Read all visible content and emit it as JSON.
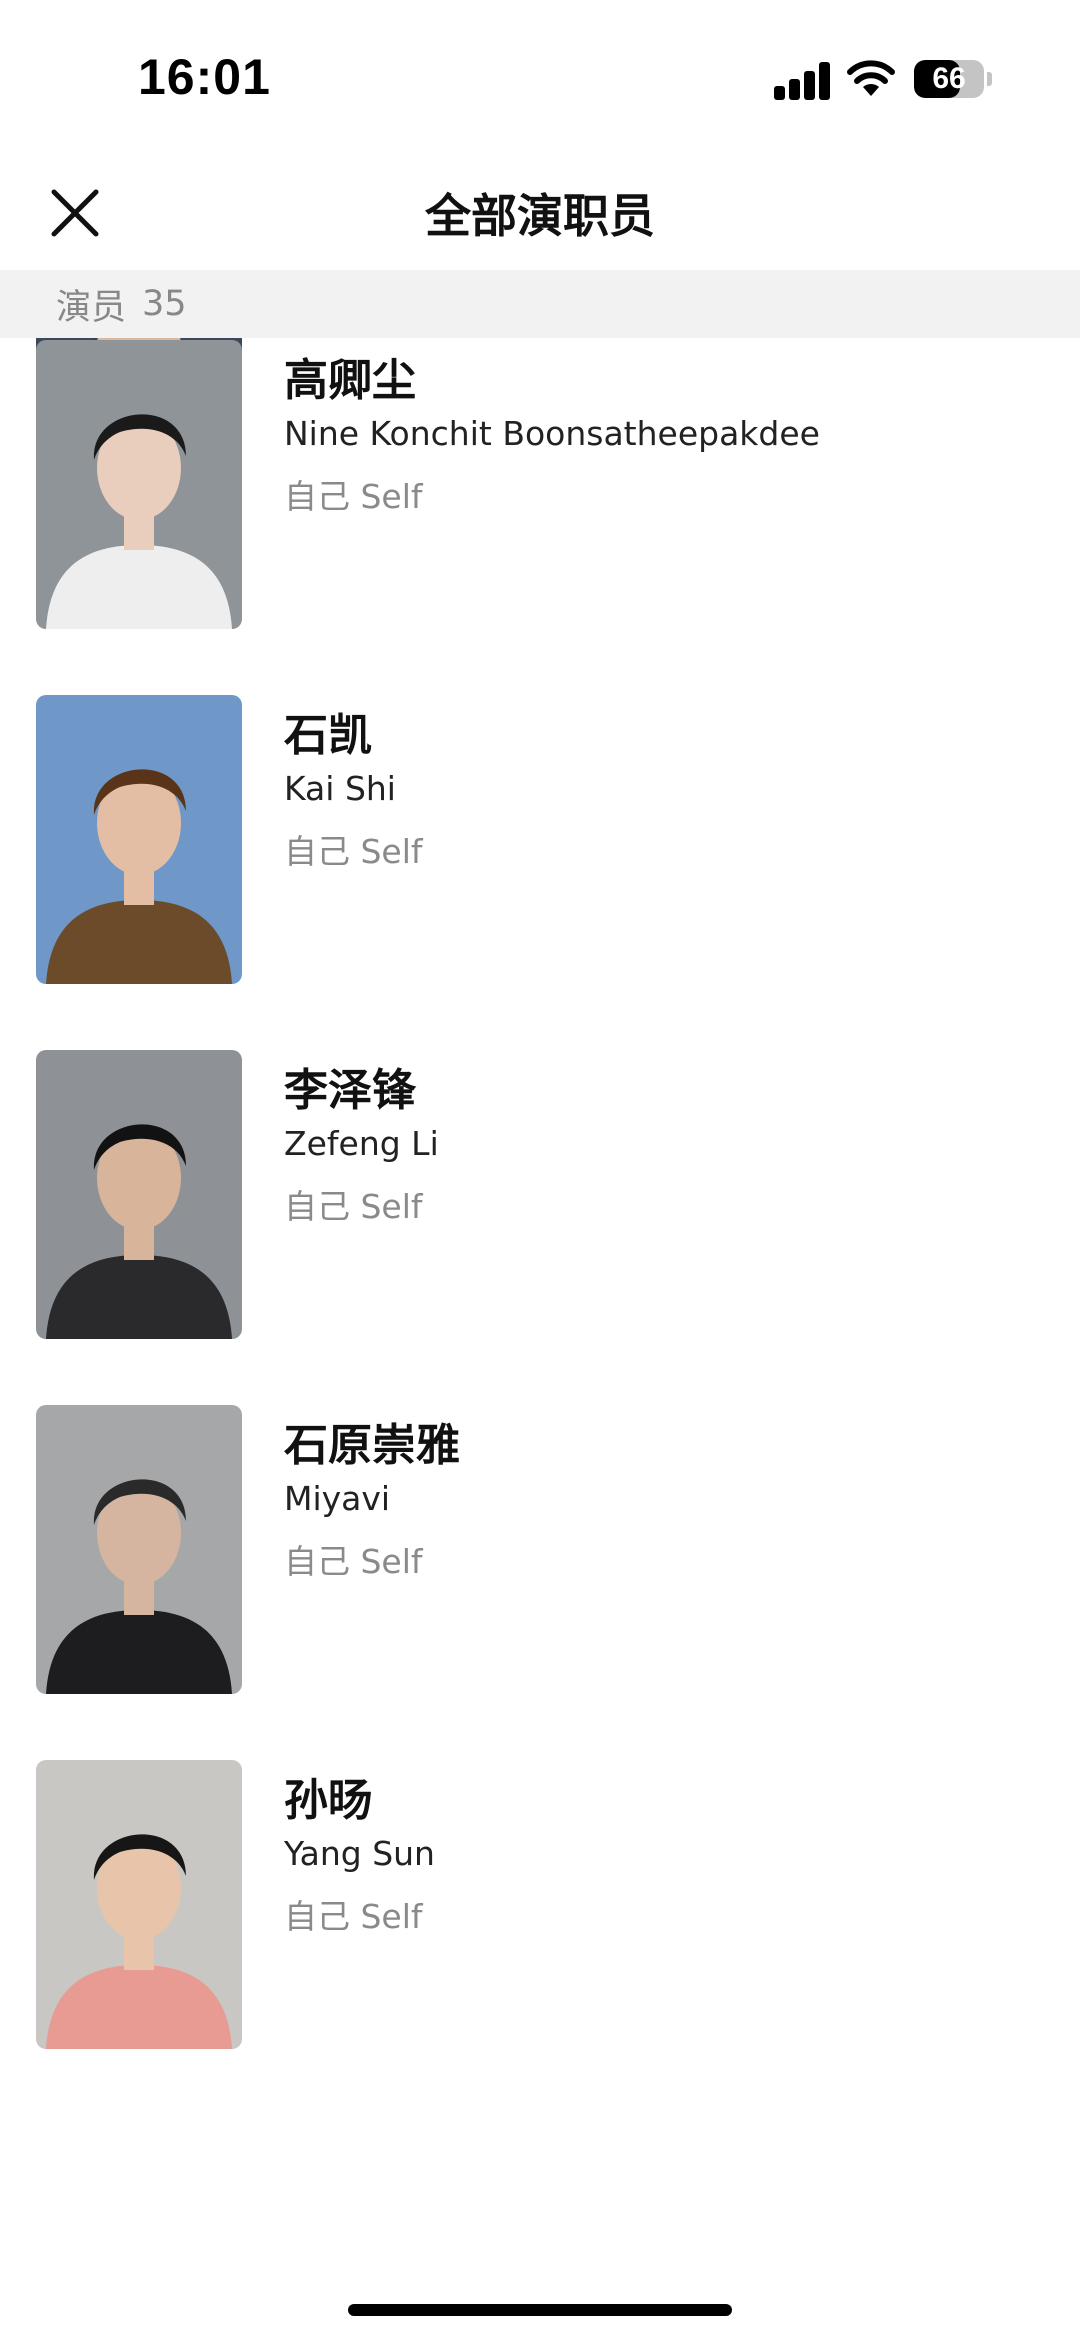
{
  "status_bar": {
    "time": "16:01",
    "battery": "66",
    "battery_level": 0.66
  },
  "nav": {
    "title": "全部演职员",
    "close_icon": "close-icon"
  },
  "section": {
    "label": "演员",
    "count": "35"
  },
  "cast": [
    {
      "name_cn": "",
      "name_en": "",
      "role": "",
      "photo_colors": {
        "bg": "#3a4a5c",
        "clothes": "#c9d3de",
        "skin": "#d9b8a0",
        "hair": "#1c1c1c"
      }
    },
    {
      "name_cn": "高卿尘",
      "name_en": "Nine Konchit Boonsatheepakdee",
      "role": "自己 Self",
      "photo_colors": {
        "bg": "#8f9499",
        "clothes": "#eeeeee",
        "skin": "#e9cdbd",
        "hair": "#1a1a1a"
      }
    },
    {
      "name_cn": "石凯",
      "name_en": "Kai Shi",
      "role": "自己 Self",
      "photo_colors": {
        "bg": "#6f98c9",
        "clothes": "#6b4b2a",
        "skin": "#e4bea4",
        "hair": "#5a3418"
      }
    },
    {
      "name_cn": "李泽锋",
      "name_en": "Zefeng Li",
      "role": "自己 Self",
      "photo_colors": {
        "bg": "#8e9296",
        "clothes": "#2a2a2c",
        "skin": "#d8b49a",
        "hair": "#121212"
      }
    },
    {
      "name_cn": "石原崇雅",
      "name_en": "Miyavi",
      "role": "自己 Self",
      "photo_colors": {
        "bg": "#a5a7a8",
        "clothes": "#1d1d1f",
        "skin": "#d6b5a0",
        "hair": "#2a2a2a"
      }
    },
    {
      "name_cn": "孙旸",
      "name_en": "Yang Sun",
      "role": "自己 Self",
      "photo_colors": {
        "bg": "#c8c7c3",
        "clothes": "#e89b93",
        "skin": "#e8c4aa",
        "hair": "#161616"
      }
    }
  ]
}
